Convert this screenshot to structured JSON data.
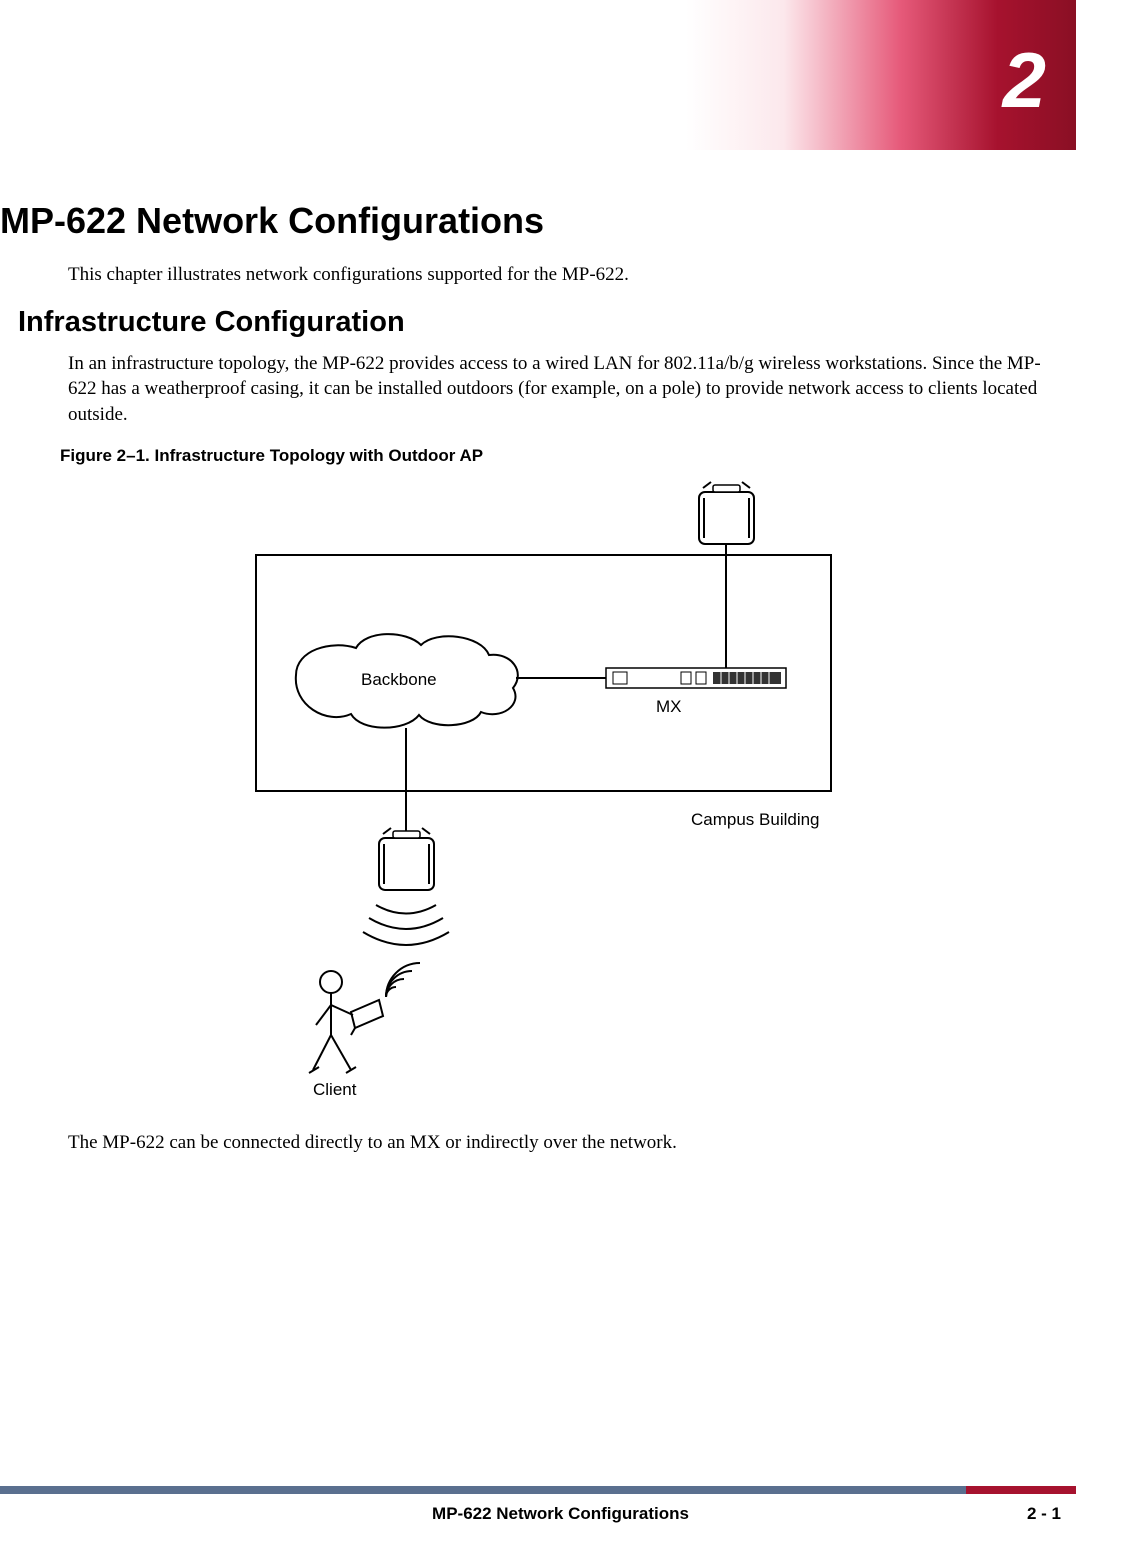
{
  "chapter": {
    "number": "2",
    "title": "MP-622 Network Configurations",
    "intro": "This chapter illustrates network configurations supported for the MP-622."
  },
  "section": {
    "title": "Infrastructure Configuration",
    "para1": "In an infrastructure topology, the MP-622 provides access to a wired LAN for 802.11a/b/g wireless workstations. Since the MP-622 has a weatherproof casing, it can be installed outdoors (for example, on a pole) to provide network access to clients located outside.",
    "figure_caption": "Figure 2–1.  Infrastructure Topology with Outdoor AP",
    "para2": "The MP-622 can be connected directly to an MX or indirectly over the network."
  },
  "diagram": {
    "backbone_label": "Backbone",
    "mx_label": "MX",
    "building_label": "Campus Building",
    "client_label": "Client"
  },
  "footer": {
    "title": "MP-622 Network Configurations",
    "page": "2 - 1"
  }
}
